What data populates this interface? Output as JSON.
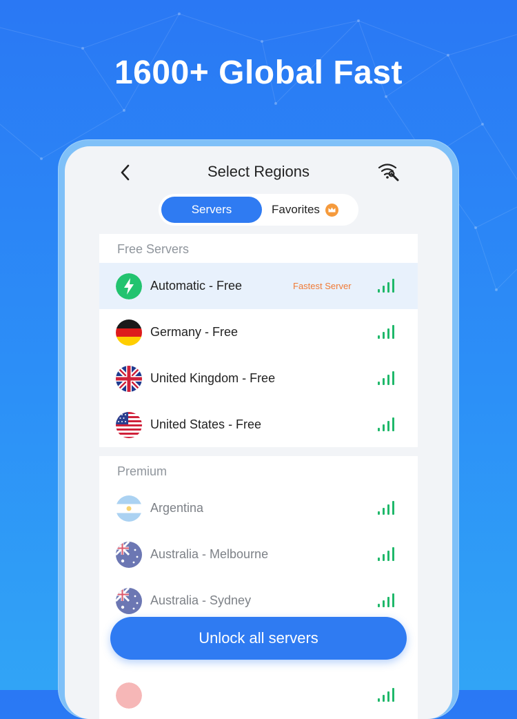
{
  "headline": "1600+ Global Fast",
  "header": {
    "title": "Select Regions"
  },
  "tabs": {
    "active": "Servers",
    "other": "Favorites"
  },
  "free": {
    "heading": "Free Servers",
    "fastest_tag": "Fastest Server",
    "items": [
      {
        "label": "Automatic - Free",
        "icon": "lightning-icon"
      },
      {
        "label": "Germany - Free",
        "icon": "germany-flag"
      },
      {
        "label": "United Kingdom - Free",
        "icon": "uk-flag"
      },
      {
        "label": "United States - Free",
        "icon": "us-flag"
      }
    ]
  },
  "premium": {
    "heading": "Premium",
    "items": [
      {
        "label": "Argentina",
        "icon": "argentina-flag"
      },
      {
        "label": "Australia - Melbourne",
        "icon": "australia-flag"
      },
      {
        "label": "Australia - Sydney",
        "icon": "australia-flag"
      }
    ]
  },
  "unlock_label": "Unlock all servers",
  "colors": {
    "accent": "#2f7bf2",
    "signal_green": "#1fb86a",
    "fastest_orange": "#f07a35",
    "highlight_row": "#e8f1fc"
  }
}
